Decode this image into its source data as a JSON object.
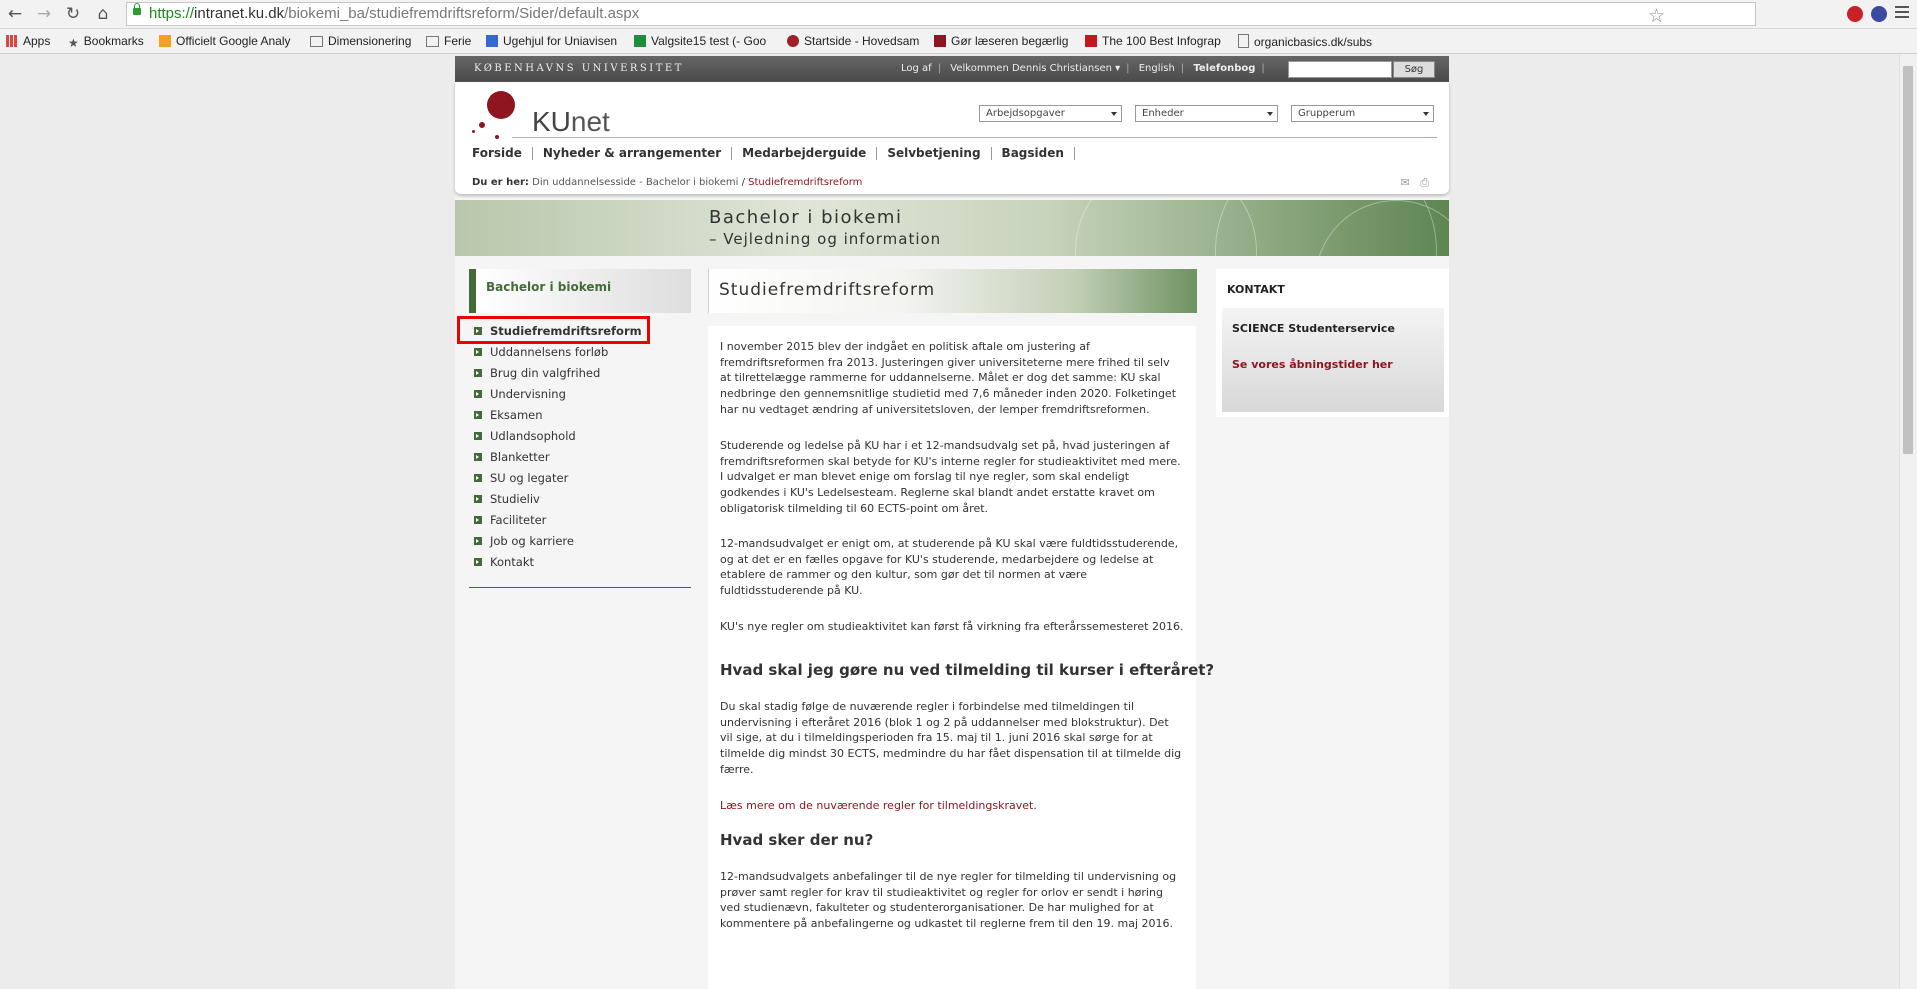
{
  "browser": {
    "url_scheme": "https://",
    "url_host": "intranet.ku.dk",
    "url_path": "/biokemi_ba/studiefremdriftsreform/Sider/default.aspx",
    "bookmarks": [
      "Apps",
      "Bookmarks",
      "Officielt Google Analy",
      "Dimensionering",
      "Ferie",
      "Ugehjul for Uniavisen",
      "Valgsite15 test (- Goo",
      "Startside - Hovedsam",
      "Gør læseren begærlig",
      "The 100 Best Infograp",
      "organicbasics.dk/subs"
    ]
  },
  "topbar": {
    "university": "KØBENHAVNS UNIVERSITET",
    "logout": "Log af",
    "welcome": "Velkommen Dennis Christiansen ▾",
    "english": "English",
    "phonebook": "Telefonbog",
    "search_button": "Søg"
  },
  "header": {
    "logo_ku": "KU",
    "logo_net": "net",
    "selects": [
      "Arbejdsopgaver",
      "Enheder",
      "Grupperum"
    ],
    "nav": [
      "Forside",
      "Nyheder & arrangementer",
      "Medarbejderguide",
      "Selvbetjening",
      "Bagsiden"
    ]
  },
  "breadcrumb": {
    "label": "Du er her:",
    "parent": "Din uddannelsesside - Bachelor i biokemi",
    "separator": "/",
    "current": "Studiefremdriftsreform"
  },
  "banner": {
    "title": "Bachelor i biokemi",
    "subtitle": "– Vejledning og information"
  },
  "leftnav": {
    "heading": "Bachelor i biokemi",
    "items": [
      "Studiefremdriftsreform",
      "Uddannelsens forløb",
      "Brug din valgfrihed",
      "Undervisning",
      "Eksamen",
      "Udlandsophold",
      "Blanketter",
      "SU og legater",
      "Studieliv",
      "Faciliteter",
      "Job og karriere",
      "Kontakt"
    ]
  },
  "main": {
    "title": "Studiefremdriftsreform",
    "p1": "I november 2015 blev der indgået en politisk aftale om justering af fremdriftsreformen fra 2013. Justeringen giver universiteterne mere frihed til selv at tilrettelægge rammerne for uddannelserne. Målet er dog det samme: KU skal nedbringe den gennemsnitlige studietid med 7,6 måneder inden 2020. Folketinget har nu vedtaget ændring af universitetsloven, der lemper fremdriftsreformen.",
    "p2": "Studerende og ledelse på KU har i et 12-mandsudvalg set på, hvad justeringen af fremdriftsreformen skal betyde for KU's interne regler for studieaktivitet med mere. I udvalget er man blevet enige om forslag til nye regler, som skal endeligt godkendes i KU's Ledelsesteam. Reglerne skal blandt andet erstatte kravet om obligatorisk tilmelding til 60 ECTS-point om året.",
    "p3": "12-mandsudvalget er enigt om, at studerende på KU skal være fuldtidsstuderende, og at det er en fælles opgave for KU's studerende, medarbejdere og ledelse at etablere de rammer og den kultur, som gør det til normen at være fuldtidsstuderende på KU.",
    "p4": "KU's nye regler om studieaktivitet kan først få virkning fra efterårssemesteret 2016.",
    "h1": "Hvad skal jeg gøre nu ved tilmelding til kurser i efteråret?",
    "p5": "Du skal stadig følge de nuværende regler i forbindelse med tilmeldingen til undervisning i efteråret 2016 (blok 1 og 2 på uddannelser med blokstruktur). Det vil sige, at du i tilmeldingsperioden fra 15. maj til 1. juni 2016 skal sørge for at tilmelde dig mindst 30 ECTS, medmindre du har fået dispensation til at tilmelde dig færre.",
    "link": "Læs mere om de nuværende regler for tilmeldingskravet",
    "link_after": ".",
    "h2": "Hvad sker der nu?",
    "p6": "12-mandsudvalgets anbefalinger til de nye regler for tilmelding til undervisning og prøver samt regler for krav til studieaktivitet og regler for orlov er sendt i høring ved studienævn, fakulteter og studenterorganisationer. De har mulighed for at kommentere på anbefalingerne og udkastet til reglerne frem til den 19. maj 2016."
  },
  "contact": {
    "heading": "KONTAKT",
    "name": "SCIENCE Studenterservice",
    "link": "Se vores åbningstider her"
  },
  "colors": {
    "ku_red": "#8f1621",
    "green": "#436b39",
    "highlight": "#e00000"
  }
}
